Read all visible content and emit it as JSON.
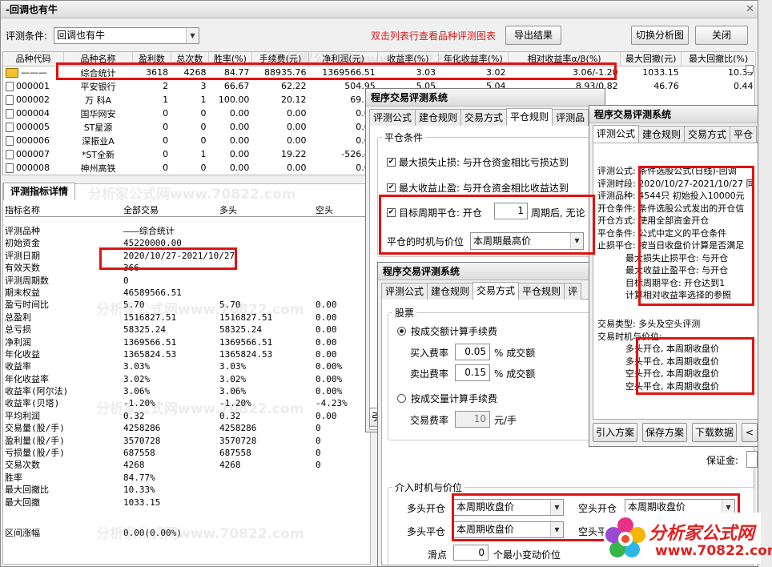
{
  "main": {
    "title": "-回调也有牛",
    "condition_label": "评测条件:",
    "condition_value": "回调也有牛",
    "hint": "双击列表行查看品种评测图表",
    "export_btn": "导出结果",
    "switch_btn": "切换分析图",
    "close_btn": "关闭",
    "headers": [
      "品种代码",
      "品种名称",
      "盈利数",
      "总次数",
      "胜率(%)",
      "手续费(元)",
      "净利润(元)",
      "收益率(%)",
      "年化收益率(%)",
      "相对收益率α/β(%)",
      "最大回撤(元)",
      "最大回撤比(%)"
    ],
    "rows": [
      [
        "———",
        "综合统计",
        "3618",
        "4268",
        "84.77",
        "88935.76",
        "1369566.51",
        "3.03",
        "3.02",
        "3.06/-1.20",
        "1033.15",
        "10.33"
      ],
      [
        "000001",
        "平安银行",
        "2",
        "3",
        "66.67",
        "62.22",
        "504.95",
        "5.05",
        "5.04",
        "8.93/0.82",
        "46.76",
        "0.44"
      ],
      [
        "000002",
        "万 科A",
        "1",
        "1",
        "100.00",
        "20.12",
        "69.18",
        "",
        "",
        "",
        "",
        ""
      ],
      [
        "000004",
        "国华网安",
        "0",
        "0",
        "0.00",
        "0.00",
        "0.00",
        "",
        "",
        "",
        "",
        ""
      ],
      [
        "000005",
        "ST星源",
        "0",
        "0",
        "0.00",
        "0.00",
        "0.00",
        "",
        "",
        "",
        "",
        ""
      ],
      [
        "000006",
        "深振业A",
        "0",
        "0",
        "0.00",
        "0.00",
        "0.00",
        "",
        "",
        "",
        "",
        ""
      ],
      [
        "000007",
        "*ST全新",
        "0",
        "1",
        "0.00",
        "19.22",
        "-526.42",
        "",
        "",
        "",
        "",
        ""
      ],
      [
        "000008",
        "神州高铁",
        "0",
        "0",
        "0.00",
        "0.00",
        "0.00",
        "",
        "",
        "",
        "",
        ""
      ]
    ]
  },
  "detail": {
    "tab": "评测指标详情",
    "headers": [
      "指标名称",
      "全部交易",
      "多头",
      "空头"
    ],
    "rows": [
      [
        "评测品种",
        "———综合统计",
        "",
        ""
      ],
      [
        "初始资金",
        "45220000.00",
        "",
        ""
      ],
      [
        "评测日期",
        "2020/10/27-2021/10/27",
        "",
        ""
      ],
      [
        "有效天数",
        "366",
        "",
        ""
      ],
      [
        "评测周期数",
        "0",
        "",
        ""
      ],
      [
        "期末权益",
        "46589566.51",
        "",
        ""
      ],
      [
        "盈亏时间比",
        "5.70",
        "5.70",
        "0.00"
      ],
      [
        "总盈利",
        "1516827.51",
        "1516827.51",
        "0.00"
      ],
      [
        "总亏损",
        "58325.24",
        "58325.24",
        "0.00"
      ],
      [
        "净利润",
        "1369566.51",
        "1369566.51",
        "0.00"
      ],
      [
        "年化收益",
        "1365824.53",
        "1365824.53",
        "0.00"
      ],
      [
        "收益率",
        "3.03%",
        "3.03%",
        "0.00%"
      ],
      [
        "年化收益率",
        "3.02%",
        "3.02%",
        "0.00%"
      ],
      [
        "收益率(阿尔法)",
        "3.06%",
        "3.06%",
        "0.00%"
      ],
      [
        "收益率(贝塔)",
        "-1.20%",
        "-1.20%",
        "-4.23%"
      ],
      [
        "平均利润",
        "0.32",
        "0.32",
        "0.00"
      ],
      [
        "交易量(股/手)",
        "4258286",
        "4258286",
        "0"
      ],
      [
        "盈利量(股/手)",
        "3570728",
        "3570728",
        "0"
      ],
      [
        "亏损量(股/手)",
        "687558",
        "687558",
        "0"
      ],
      [
        "交易次数",
        "4268",
        "4268",
        "0"
      ],
      [
        "胜率",
        "84.77%",
        "",
        ""
      ],
      [
        "最大回撤比",
        "10.33%",
        "",
        ""
      ],
      [
        "最大回撤",
        "1033.15",
        "",
        ""
      ],
      [
        "",
        "",
        " ",
        ""
      ],
      [
        "区间涨幅",
        "0.00(0.00%)",
        "",
        ""
      ]
    ]
  },
  "dlg1": {
    "title": "程序交易评测系统",
    "tabs": [
      "评测公式",
      "建仓规则",
      "交易方式",
      "平仓规则",
      "评测品"
    ],
    "group": "平仓条件",
    "stoploss": "最大损失止损: 与开仓资金相比亏损达到",
    "takeprofit": "最大收益止盈: 与开仓资金相比收益达到",
    "period_a": "目标周期平仓: 开仓",
    "period_val": "1",
    "period_b": "周期后, 无论",
    "timing_label": "平仓的时机与价位",
    "timing_value": "本周期最高价",
    "side_letter": "引"
  },
  "dlg2": {
    "title": "程序交易评测系统",
    "tabs": [
      "评测公式",
      "建仓规则",
      "交易方式",
      "平仓规则",
      "评"
    ],
    "stock_group": "股票",
    "by_amount": "按成交额计算手续费",
    "buy_label": "买入费率",
    "buy_val": "0.05",
    "buy_unit": "% 成交额",
    "sell_label": "卖出费率",
    "sell_val": "0.15",
    "sell_unit": "% 成交额",
    "by_volume": "按成交量计算手续费",
    "fee_label": "交易费率",
    "fee_val": "10",
    "fee_unit": "元/手",
    "entry_group": "介入时机与价位",
    "long_open": "多头开仓",
    "long_open_val": "本周期收盘价",
    "short_open": "空头开仓",
    "short_open_val": "本周期收盘价",
    "long_close": "多头平仓",
    "long_close_val": "本周期收盘价",
    "short_close": "空头平",
    "slip_label": "滑点",
    "slip_val": "0",
    "slip_unit": "个最小变动价位",
    "margin_label": "保证金:"
  },
  "dlg3": {
    "title": "程序交易评测系统",
    "tabs": [
      "评测公式",
      "建仓规则",
      "交易方式",
      "平仓"
    ],
    "lines": [
      "评测公式: 条件选股公式(日线)-回调",
      "评测时段: 2020/10/27-2021/10/27 同",
      "评测品种: 4544只 初始投入10000元",
      "开仓条件: 条件选股公式发出的开仓信",
      "开仓方式: 使用全部资金开仓",
      "平仓条件: 公式中定义的平仓条件",
      "止损平仓: 按当日收盘价计算是否满足",
      "          最大损失止损平仓: 与开仓",
      "          最大收益止盈平仓: 与开仓",
      "          目标周期平仓: 开仓达到1",
      "          计算相对收益率选择的参照"
    ],
    "lines2": [
      "交易类型: 多头及空头评测",
      "交易时机与价位:",
      "          多头开仓, 本周期收盘价",
      "          多头平仓, 本周期收盘价",
      "          空头开仓, 本周期收盘价",
      "          空头平仓, 本周期收盘价"
    ],
    "btn_import": "引入方案",
    "btn_save": "保存方案",
    "btn_download": "下载数据",
    "btn_more": "<"
  },
  "watermark": "分析家公式网www.70822.com",
  "logo": {
    "line1": "分析家公式网",
    "line2": "www.70822.com"
  },
  "colors": {
    "red": "#e01212",
    "hint": "#d31a1a",
    "logo_red": "#e02020"
  }
}
